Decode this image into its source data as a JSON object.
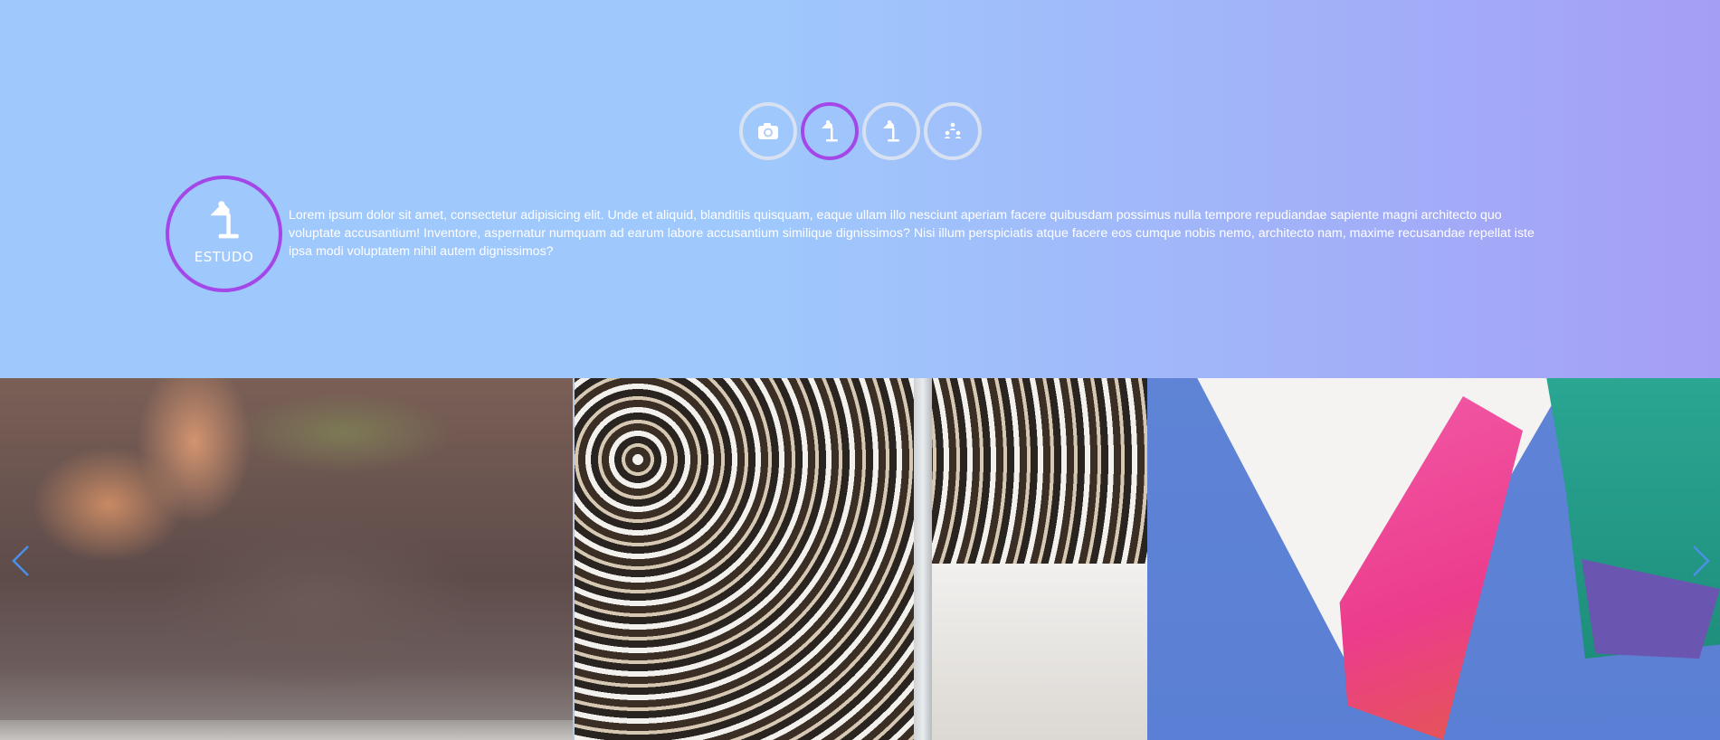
{
  "tabs": [
    {
      "icon": "camera-icon",
      "active": false
    },
    {
      "icon": "desk-lamp-icon",
      "active": true
    },
    {
      "icon": "desk-lamp-icon",
      "active": false
    },
    {
      "icon": "people-icon",
      "active": false
    }
  ],
  "feature": {
    "icon": "desk-lamp-icon",
    "label": "ESTUDO",
    "description": "Lorem ipsum dolor sit amet, consectetur adipisicing elit. Unde et aliquid, blanditiis quisquam, eaque ullam illo nesciunt aperiam facere quibusdam possimus nulla tempore repudiandae sapiente magni architecto quo voluptate accusantium! Inventore, aspernatur numquam ad earum labore accusantium similique dignissimos? Nisi illum perspiciatis atque facere eos cumque nobis nemo, architecto nam, maxime recusandae repellat iste ipsa modi voluptatem nihil autem dignissimos?"
  },
  "gallery": {
    "slides": [
      "photo-hands-water",
      "photo-iron-gate",
      "photo-flags"
    ],
    "prev_icon": "chevron-left-icon",
    "next_icon": "chevron-right-icon"
  },
  "colors": {
    "accent": "#a447e8",
    "ring": "#d7e1f1",
    "background": "#9fc8fc",
    "arrow": "#4a90e8"
  }
}
